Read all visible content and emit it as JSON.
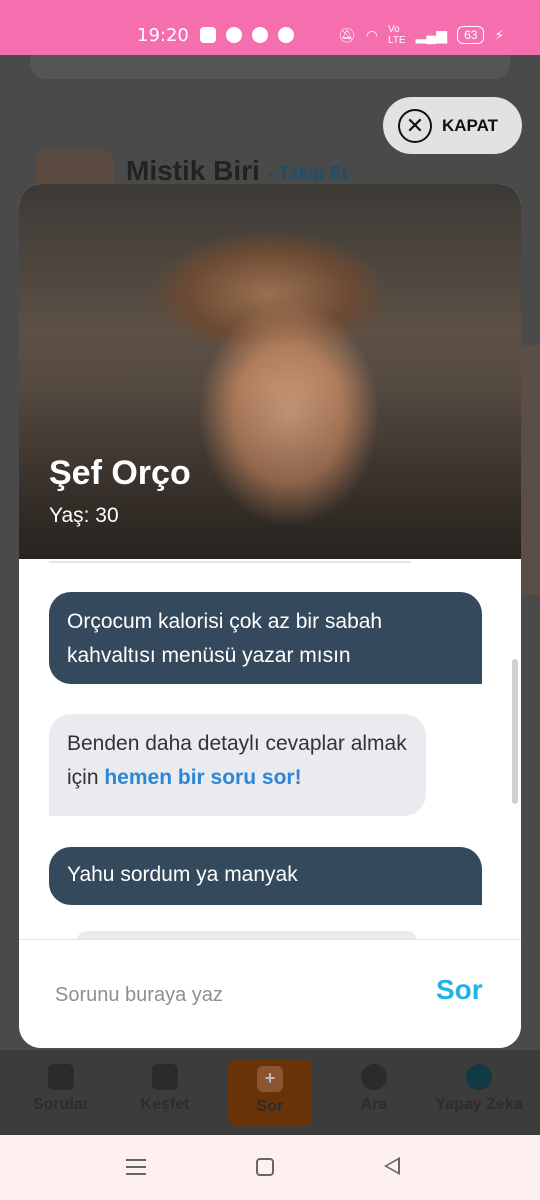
{
  "status_bar": {
    "time": "19:20",
    "battery": "63"
  },
  "background": {
    "profile_name": "Mistik Biri",
    "follow_label": "- Takip Et",
    "close_label": "KAPAT"
  },
  "profile": {
    "name": "Şef Orço",
    "age": "Yaş: 30"
  },
  "messages": [
    {
      "role": "user",
      "text": "Orçocum kalorisi çok az bir sabah kahvaltısı menüsü yazar mısın"
    },
    {
      "role": "bot",
      "text": "Benden daha detaylı cevaplar almak için",
      "link": "hemen bir soru sor!"
    },
    {
      "role": "user",
      "text": "Yahu sordum ya manyak"
    }
  ],
  "input": {
    "placeholder": "Sorunu buraya yaz",
    "send_label": "Sor"
  },
  "bottom_nav": [
    {
      "label": "Sorular",
      "icon": "question-bubble-icon"
    },
    {
      "label": "Keşfet",
      "icon": "cards-icon"
    },
    {
      "label": "Sor",
      "icon": "plus-icon",
      "active": true
    },
    {
      "label": "Ara",
      "icon": "search-icon"
    },
    {
      "label": "Yapay Zeka",
      "icon": "ai-icon"
    }
  ],
  "colors": {
    "status_bar": "#f56fae",
    "user_bubble": "#344a5c",
    "bot_bubble": "#e9ebef",
    "link": "#2c86d6",
    "send": "#22b3e6"
  }
}
